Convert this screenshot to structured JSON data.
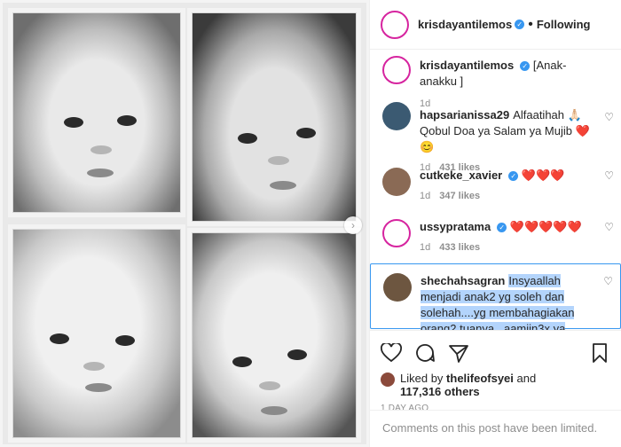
{
  "post": {
    "author": "krisdayantilemos",
    "follow_label": "Following",
    "separator": "•",
    "caption_user": "krisdayantilemos",
    "caption": "[Anak-anakku ]",
    "caption_age": "1d"
  },
  "comments": [
    {
      "user": "hapsarianissa29",
      "text": "Alfaatihah 🙏🏻 Qobul Doa ya Salam ya Mujib ❤️😊",
      "age": "1d",
      "likes": "431 likes",
      "verified": false
    },
    {
      "user": "cutkeke_xavier",
      "text": "❤️❤️❤️",
      "age": "1d",
      "likes": "347 likes",
      "verified": true
    },
    {
      "user": "ussypratama",
      "text": "❤️❤️❤️❤️❤️",
      "age": "1d",
      "likes": "433 likes",
      "verified": true
    },
    {
      "user": "shechahsagran",
      "text": "Insyaallah menjadi anak2 yg soleh dan solehah....yg membahagiakan orang2 tuanya...aamiin3x ya"
    }
  ],
  "likes": {
    "prefix": "Liked by",
    "user": "thelifeofsyei",
    "middle": "and",
    "count": "117,316 others"
  },
  "timestamp": "1 DAY AGO",
  "limited_text": "Comments on this post have been limited.",
  "colors": {
    "verified": "#3897f0",
    "heart": "#ed4956",
    "selection": "#b3d4fc",
    "story_ring": "#d6249f"
  },
  "icons": [
    "heart-icon",
    "comment-icon",
    "share-icon",
    "bookmark-icon",
    "chevron-right-icon",
    "verified-icon"
  ]
}
